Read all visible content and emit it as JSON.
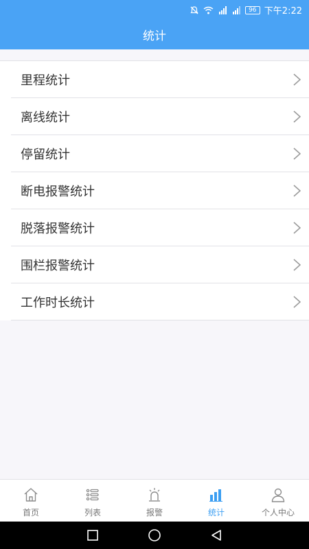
{
  "status_bar": {
    "battery": "96",
    "time": "下午2:22",
    "icons": [
      "mute-icon",
      "wifi-icon",
      "signal-2g-icon",
      "signal-4g-icon",
      "battery-icon"
    ]
  },
  "header": {
    "title": "统计"
  },
  "stats_list": {
    "items": [
      {
        "label": "里程统计"
      },
      {
        "label": "离线统计"
      },
      {
        "label": "停留统计"
      },
      {
        "label": "断电报警统计"
      },
      {
        "label": "脱落报警统计"
      },
      {
        "label": "围栏报警统计"
      },
      {
        "label": "工作时长统计"
      }
    ]
  },
  "tabbar": {
    "active_color": "#3b9ef2",
    "inactive_color": "#777777",
    "tabs": [
      {
        "label": "首页",
        "icon": "home-icon"
      },
      {
        "label": "列表",
        "icon": "list-icon"
      },
      {
        "label": "报警",
        "icon": "alarm-icon"
      },
      {
        "label": "统计",
        "icon": "bar-chart-icon",
        "active": true
      },
      {
        "label": "个人中心",
        "icon": "person-icon"
      }
    ]
  },
  "colors": {
    "header_bg": "#4aa3f5",
    "page_bg": "#f7f6fa"
  }
}
